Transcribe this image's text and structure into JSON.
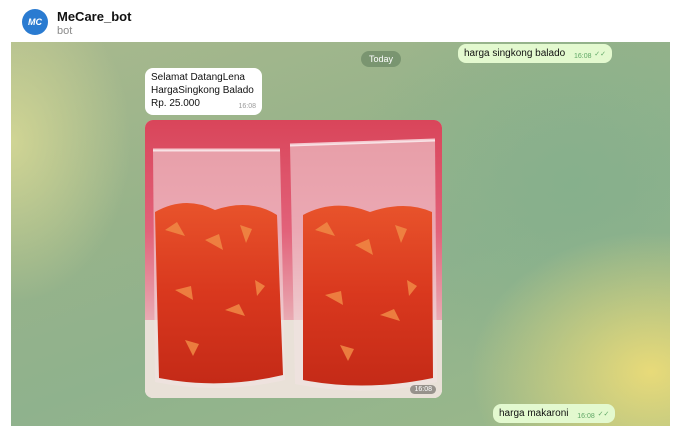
{
  "header": {
    "avatar_text": "MC",
    "title": "MeCare_bot",
    "subtitle": "bot"
  },
  "chat": {
    "date_label": "Today",
    "messages": [
      {
        "from": "user",
        "text": "harga singkong balado",
        "time": "16:08"
      },
      {
        "from": "bot",
        "lines": [
          "Selamat DatangLena",
          "HargaSingkong Balado",
          "Rp. 25.000"
        ],
        "time": "16:08"
      },
      {
        "from": "bot",
        "type": "photo",
        "description": "two clear bags of red spicy cassava chips",
        "time": "16:08"
      },
      {
        "from": "user",
        "text": "harga makaroni",
        "time": "16:08"
      }
    ]
  },
  "colors": {
    "outgoing_bubble": "#e3f9cf",
    "incoming_bubble": "#ffffff",
    "read_check": "#5fa765",
    "avatar": "#2a7bd1"
  }
}
